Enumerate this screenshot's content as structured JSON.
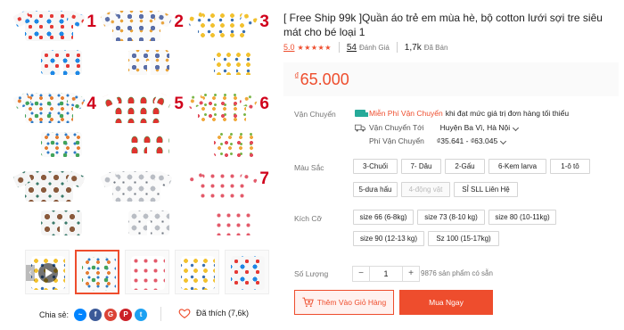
{
  "gallery": {
    "numbers": [
      "1",
      "2",
      "3",
      "4",
      "5",
      "6",
      "7"
    ]
  },
  "share": {
    "label": "Chia sẻ:",
    "networks": [
      "messenger-icon",
      "facebook-icon",
      "google-plus-icon",
      "pinterest-icon",
      "twitter-icon"
    ],
    "liked": "Đã thích (7,6k)"
  },
  "product": {
    "title": "[ Free Ship 99k ]Quần áo trẻ em mùa hè, bộ cotton lưới sợi tre siêu mát cho bé loại 1",
    "rating": "5.0",
    "stars": "★★★★★",
    "reviews_count": "54",
    "reviews_label": "Đánh Giá",
    "sold_count": "1,7k",
    "sold_label": "Đã Bán",
    "currency": "₫",
    "price": "65.000"
  },
  "shipping": {
    "label": "Vận Chuyển",
    "free_text": "Miễn Phí Vận Chuyển",
    "free_condition": "khi đạt mức giá trị đơn hàng tối thiểu",
    "to_label": "Vận Chuyển Tới",
    "to_value": "Huyện Ba Vì, Hà Nội",
    "fee_label": "Phí Vận Chuyển",
    "fee_value": "₫35.641 - ₫63.045"
  },
  "colors": {
    "label": "Màu Sắc",
    "options": [
      "3-Chuối",
      "7- Dâu",
      "2-Gấu",
      "6-Kem larva",
      "1-ô tô",
      "5-dưa hấu",
      "4-động vật",
      "SỈ SLL Liên Hệ"
    ]
  },
  "sizes": {
    "label": "Kích Cỡ",
    "options": [
      "size 66 (6-8kg)",
      "size 73 (8-10 kg)",
      "size 80 (10-11kg)",
      "size 90 (12-13 kg)",
      "Sz 100 (15-17kg)"
    ]
  },
  "quantity": {
    "label": "Số Lượng",
    "minus": "−",
    "value": "1",
    "plus": "+",
    "stock": "9876 sản phẩm có sẵn"
  },
  "actions": {
    "add_to_cart": "Thêm Vào Giỏ Hàng",
    "buy_now": "Mua Ngay"
  },
  "colors_theme": {
    "accent": "#ee4d2d",
    "free_ship": "#26aa99",
    "number_red": "#d0011b"
  }
}
